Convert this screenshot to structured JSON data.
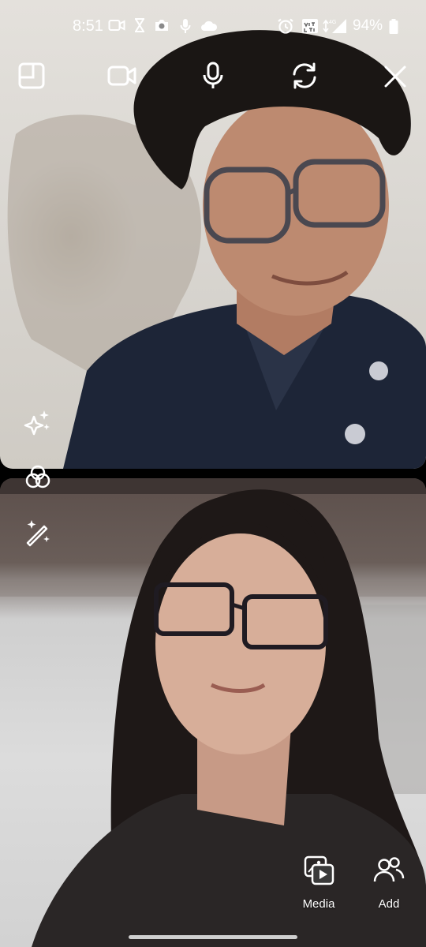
{
  "status_bar": {
    "time": "8:51",
    "battery": "94%",
    "network": "4G",
    "icons": [
      "video-call-icon",
      "hourglass-icon",
      "camera-icon",
      "mic-icon",
      "cloud-icon",
      "alarm-icon",
      "volte-icon",
      "signal-icon",
      "battery-icon"
    ]
  },
  "call_controls": {
    "icons": [
      "layout-icon",
      "video-toggle-icon",
      "mic-toggle-icon",
      "flip-camera-icon",
      "close-icon"
    ]
  },
  "effects": {
    "icons": [
      "sparkles-icon",
      "filters-icon",
      "magic-wand-icon"
    ]
  },
  "bottom_actions": {
    "media_label": "Media",
    "add_label": "Add"
  }
}
